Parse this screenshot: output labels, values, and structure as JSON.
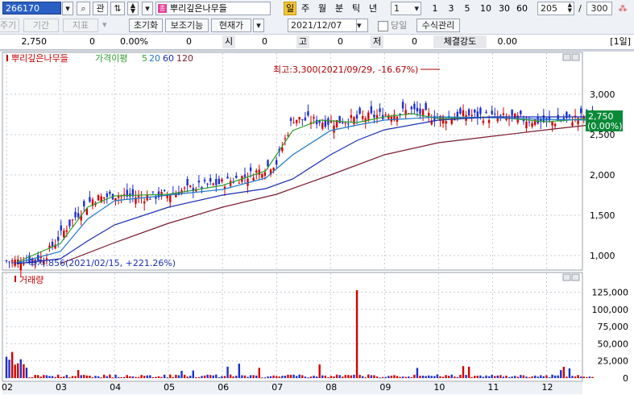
{
  "toolbar": {
    "code": "266170",
    "gwan": "관",
    "stock_name": "뿌리깊은나무들",
    "periods": [
      "일",
      "주",
      "월",
      "분",
      "틱",
      "년"
    ],
    "selected_period": "일",
    "interval_value": "1",
    "intervals": [
      "1",
      "3",
      "5",
      "10",
      "30",
      "60"
    ],
    "count_value": "205",
    "count_sep": "/",
    "count_total": "300"
  },
  "toolbar2": {
    "disabled_buttons": [
      "주기",
      "기간",
      "지표"
    ],
    "reset_label": "초기화",
    "aux_label": "보조기능",
    "price_type": "현재가",
    "date_value": "2021/12/07",
    "today_label": "당일",
    "formula_label": "수식관리"
  },
  "quote": {
    "price": "2,750",
    "change": "0",
    "change_pct": "0.00%",
    "volume": "0",
    "open_label": "시",
    "open": "0",
    "high_label": "고",
    "high": "0",
    "low_label": "저",
    "low": "0",
    "strength_label": "체결강도",
    "strength": "0.00",
    "period_tag": "[1일]"
  },
  "chart_data": [
    {
      "type": "candlestick",
      "title": "뿌리깊은나무들",
      "legend": [
        "가격이평",
        "5",
        "20",
        "60",
        "120"
      ],
      "x_ticks": [
        "02",
        "03",
        "04",
        "05",
        "06",
        "07",
        "08",
        "09",
        "10",
        "11",
        "12"
      ],
      "y_ticks": [
        1000,
        1500,
        2000,
        2500,
        3000
      ],
      "y_tick_labels": [
        "1,000",
        "1,500",
        "2,000",
        "2,500",
        "3,000"
      ],
      "ylim": [
        850,
        3450
      ],
      "series": [
        {
          "name": "close",
          "color": "#000000",
          "values": [
            [
              0.2,
              930
            ],
            [
              0.7,
              980
            ],
            [
              1.0,
              1250
            ],
            [
              1.3,
              1500
            ],
            [
              1.6,
              1700
            ],
            [
              2.0,
              1750
            ],
            [
              2.5,
              1720
            ],
            [
              3.0,
              1760
            ],
            [
              3.5,
              1850
            ],
            [
              4.0,
              1900
            ],
            [
              4.5,
              2000
            ],
            [
              5.0,
              2150
            ],
            [
              5.3,
              2700
            ],
            [
              5.6,
              2680
            ],
            [
              6.0,
              2650
            ],
            [
              6.5,
              2700
            ],
            [
              7.0,
              2750
            ],
            [
              7.5,
              2800
            ],
            [
              8.0,
              2700
            ],
            [
              8.5,
              2750
            ],
            [
              9.0,
              2720
            ],
            [
              9.5,
              2700
            ],
            [
              10.0,
              2650
            ],
            [
              10.5,
              2700
            ],
            [
              10.8,
              2750
            ]
          ]
        },
        {
          "name": "5",
          "color": "#2e9e2e",
          "values": [
            [
              0.2,
              920
            ],
            [
              1.0,
              1150
            ],
            [
              1.5,
              1600
            ],
            [
              2.0,
              1740
            ],
            [
              3.0,
              1760
            ],
            [
              4.0,
              1870
            ],
            [
              4.8,
              2050
            ],
            [
              5.3,
              2550
            ],
            [
              5.8,
              2680
            ],
            [
              6.5,
              2650
            ],
            [
              7.0,
              2720
            ],
            [
              7.5,
              2760
            ],
            [
              8.0,
              2700
            ],
            [
              9.0,
              2720
            ],
            [
              10.0,
              2660
            ],
            [
              10.8,
              2700
            ]
          ]
        },
        {
          "name": "20",
          "color": "#1f78c8",
          "values": [
            [
              0.2,
              910
            ],
            [
              1.0,
              1050
            ],
            [
              1.5,
              1450
            ],
            [
              2.0,
              1680
            ],
            [
              3.0,
              1750
            ],
            [
              4.0,
              1820
            ],
            [
              4.8,
              1960
            ],
            [
              5.3,
              2250
            ],
            [
              6.0,
              2550
            ],
            [
              6.5,
              2620
            ],
            [
              7.0,
              2680
            ],
            [
              8.0,
              2720
            ],
            [
              9.0,
              2710
            ],
            [
              10.0,
              2690
            ],
            [
              10.8,
              2680
            ]
          ]
        },
        {
          "name": "60",
          "color": "#1a2fb0",
          "values": [
            [
              0.2,
              900
            ],
            [
              1.0,
              960
            ],
            [
              1.5,
              1180
            ],
            [
              2.0,
              1380
            ],
            [
              3.0,
              1600
            ],
            [
              4.0,
              1750
            ],
            [
              4.8,
              1830
            ],
            [
              5.3,
              1950
            ],
            [
              6.0,
              2250
            ],
            [
              6.5,
              2430
            ],
            [
              7.0,
              2560
            ],
            [
              8.0,
              2680
            ],
            [
              9.0,
              2720
            ],
            [
              10.0,
              2720
            ],
            [
              10.8,
              2720
            ]
          ]
        },
        {
          "name": "120",
          "color": "#7a1a2e",
          "values": [
            [
              1.0,
              900
            ],
            [
              2.0,
              1160
            ],
            [
              3.0,
              1400
            ],
            [
              4.0,
              1600
            ],
            [
              5.0,
              1760
            ],
            [
              6.0,
              2000
            ],
            [
              7.0,
              2250
            ],
            [
              8.0,
              2400
            ],
            [
              9.0,
              2480
            ],
            [
              10.0,
              2560
            ],
            [
              10.8,
              2620
            ]
          ]
        }
      ],
      "annotations": {
        "high": "최고:3,300(2021/09/29, -16.67%)",
        "low": "최저:856(2021/02/15, +221.26%)",
        "current_price": "2,750",
        "current_pct": "(0.00%)"
      }
    },
    {
      "type": "bar",
      "title": "거래량",
      "y_ticks": [
        0,
        25000,
        50000,
        75000,
        100000,
        125000
      ],
      "y_tick_labels": [
        "0",
        "25,000",
        "50,000",
        "75,000",
        "100,000",
        "125,000"
      ],
      "ylim": [
        0,
        135000
      ],
      "note": "volume bars mostly small, one large spike ~128,000 mid-August"
    }
  ]
}
